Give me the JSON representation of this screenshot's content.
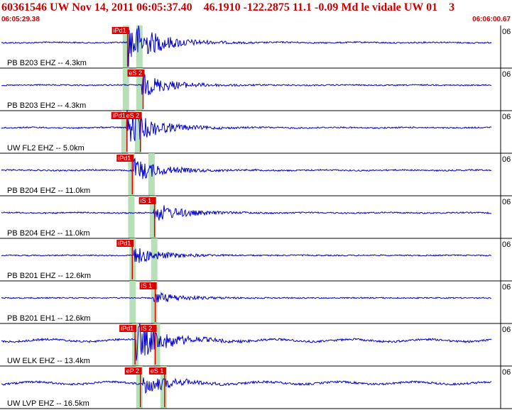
{
  "header": {
    "title": "60361546 UW Nov 14, 2011 06:05:37.40    46.1910 -122.2875 11.1 -0.09 Md le vidale UW 01    3",
    "time_start": "06:05:29.38",
    "time_end": "06:06:00.67"
  },
  "colors": {
    "header_text": "#cc0000",
    "trace": "#0000cc",
    "pick": "#dd0000",
    "pick_window": "#b8e0b8",
    "separator": "#000000"
  },
  "traces": [
    {
      "label": "PB B203 EHZ -- 4.3km",
      "right_tag": "06",
      "picks": [
        {
          "text": "iPd1",
          "t": 0.735
        }
      ],
      "windows": [
        0.72,
        0.82
      ],
      "onset": 0.735,
      "amp": 2.6,
      "noise": 0.05
    },
    {
      "label": "PB B203 EH2 -- 4.3km",
      "right_tag": "06",
      "picks": [
        {
          "text": "eS 2",
          "t": 0.85
        }
      ],
      "windows": [
        0.72,
        0.82
      ],
      "onset": 0.84,
      "amp": 1.2,
      "noise": 0.03
    },
    {
      "label": "UW FL2 EHZ -- 5.0km",
      "right_tag": "06",
      "picks": [
        {
          "text": "iPd1",
          "t": 0.73
        },
        {
          "text": "eS 2",
          "t": 0.83
        }
      ],
      "windows": [
        0.71,
        0.81
      ],
      "onset": 0.73,
      "amp": 1.9,
      "noise": 0.05
    },
    {
      "label": "PB B204 EHZ -- 11.0km",
      "right_tag": "06",
      "picks": [
        {
          "text": "iPd1",
          "t": 0.77
        }
      ],
      "windows": [
        0.76,
        0.91
      ],
      "onset": 0.78,
      "amp": 1.2,
      "noise": 0.05
    },
    {
      "label": "PB B204 EH2 -- 11.0km",
      "right_tag": "06",
      "picks": [
        {
          "text": "iS 1",
          "t": 0.935
        }
      ],
      "windows": [
        0.76,
        0.92
      ],
      "onset": 0.93,
      "amp": 1.0,
      "noise": 0.05
    },
    {
      "label": "PB B201 EHZ -- 12.6km",
      "right_tag": "06",
      "picks": [
        {
          "text": "iPd1",
          "t": 0.77
        }
      ],
      "windows": [
        0.77,
        0.93
      ],
      "onset": 0.78,
      "amp": 0.9,
      "noise": 0.02
    },
    {
      "label": "PB B201 EH1 -- 12.6km",
      "right_tag": "06",
      "picks": [
        {
          "text": "iS 1",
          "t": 0.94
        }
      ],
      "windows": [
        0.77,
        0.93
      ],
      "onset": 0.93,
      "amp": 0.6,
      "noise": 0.01
    },
    {
      "label": "UW ELK EHZ -- 13.4km",
      "right_tag": "06",
      "picks": [
        {
          "text": "iPd1",
          "t": 0.79
        },
        {
          "text": "iS 2",
          "t": 0.94
        }
      ],
      "windows": [
        0.79,
        0.95
      ],
      "onset": 0.8,
      "amp": 2.0,
      "noise": 0.2
    },
    {
      "label": "UW LVP EHZ -- 16.5km",
      "right_tag": "06",
      "picks": [
        {
          "text": "eP 2",
          "t": 0.83
        },
        {
          "text": "eS 1",
          "t": 1.01
        }
      ],
      "windows": [
        0.82,
        1.0
      ],
      "onset": 0.85,
      "amp": 1.0,
      "noise": 0.2
    }
  ]
}
